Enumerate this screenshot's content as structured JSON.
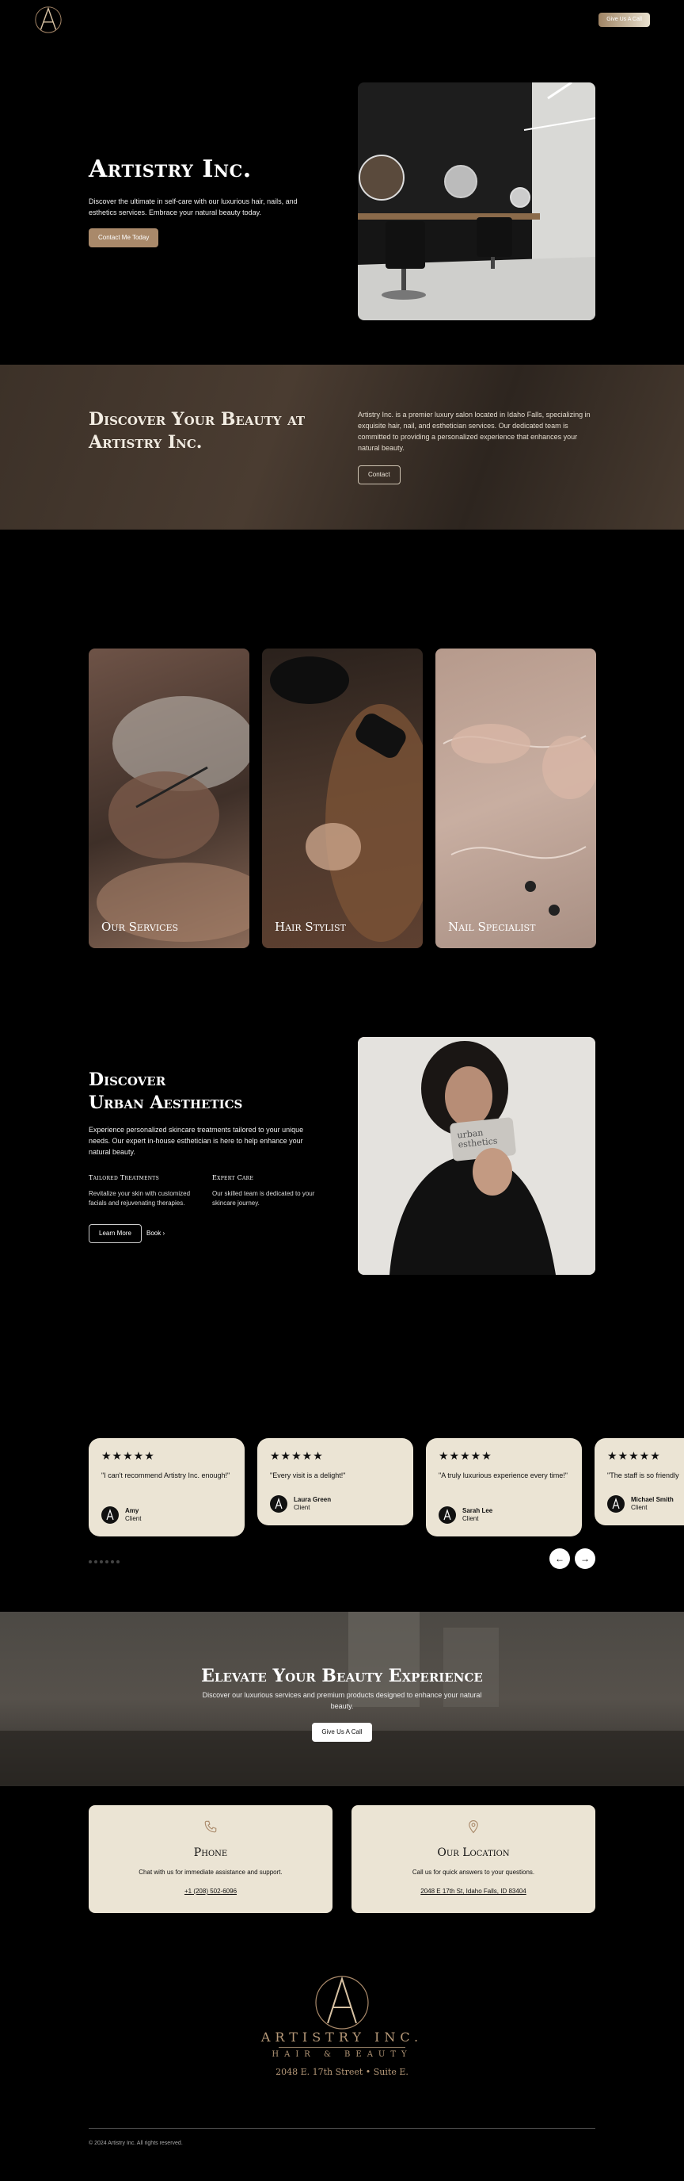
{
  "header": {
    "cta_label": "Give Us A Call"
  },
  "hero": {
    "title": "Artistry Inc.",
    "description": "Discover the ultimate in self-care with our luxurious hair, nails, and esthetics services. Embrace your natural beauty today.",
    "button_label": "Contact Me Today"
  },
  "discover": {
    "title": "Discover Your Beauty at Artistry Inc.",
    "description": "Artistry Inc. is a premier luxury salon located in Idaho Falls, specializing in exquisite hair, nail, and esthetician services. Our dedicated team is committed to providing a personalized experience that enhances your natural beauty.",
    "button_label": "Contact"
  },
  "services": {
    "cards": [
      {
        "label": "Our Services"
      },
      {
        "label": "Hair Stylist"
      },
      {
        "label": "Nail Specialist"
      }
    ]
  },
  "urban": {
    "title_line1": "Discover",
    "title_line2": "Urban Aesthetics",
    "description": "Experience personalized skincare treatments tailored to your unique needs. Our expert in-house esthetician is here to help enhance your natural beauty.",
    "features": [
      {
        "title": "Tailored Treatments",
        "text": "Revitalize your skin with customized facials and rejuvenating therapies."
      },
      {
        "title": "Expert Care",
        "text": "Our skilled team is dedicated to your skincare journey."
      }
    ],
    "learn_more_label": "Learn More",
    "book_label": "Book",
    "card_text_line1": "urban",
    "card_text_line2": "esthetics"
  },
  "testimonials": {
    "items": [
      {
        "stars": "★★★★★",
        "quote": "\"I can't recommend Artistry Inc. enough!\"",
        "name": "Amy",
        "role": "Client"
      },
      {
        "stars": "★★★★★",
        "quote": "\"Every visit is a delight!\"",
        "name": "Laura Green",
        "role": "Client"
      },
      {
        "stars": "★★★★★",
        "quote": "\"A truly luxurious experience every time!\"",
        "name": "Sarah Lee",
        "role": "Client"
      },
      {
        "stars": "★★★★★",
        "quote": "\"The staff is so friendly",
        "name": "Michael Smith",
        "role": "Client"
      }
    ],
    "prev_label": "←",
    "next_label": "→"
  },
  "elevate": {
    "title": "Elevate Your Beauty Experience",
    "description": "Discover our luxurious services and premium products designed to enhance your natural beauty.",
    "button_label": "Give Us A Call"
  },
  "contact": {
    "phone": {
      "title": "Phone",
      "description": "Chat with us for immediate assistance and support.",
      "link": "+1 (208) 502-6096"
    },
    "location": {
      "title": "Our Location",
      "description": "Call us for quick answers to your questions.",
      "link": "2048 E 17th St, Idaho Falls, ID 83404"
    }
  },
  "footer": {
    "brand": "ARTISTRY INC.",
    "subtitle": "HAIR & BEAUTY",
    "address": "2048 E. 17th Street • Suite E.",
    "copyright": "© 2024 Artistry Inc. All rights reserved."
  },
  "colors": {
    "accent": "#a9896a",
    "card_bg": "#ebe4d4",
    "gold_text": "#b59878"
  }
}
